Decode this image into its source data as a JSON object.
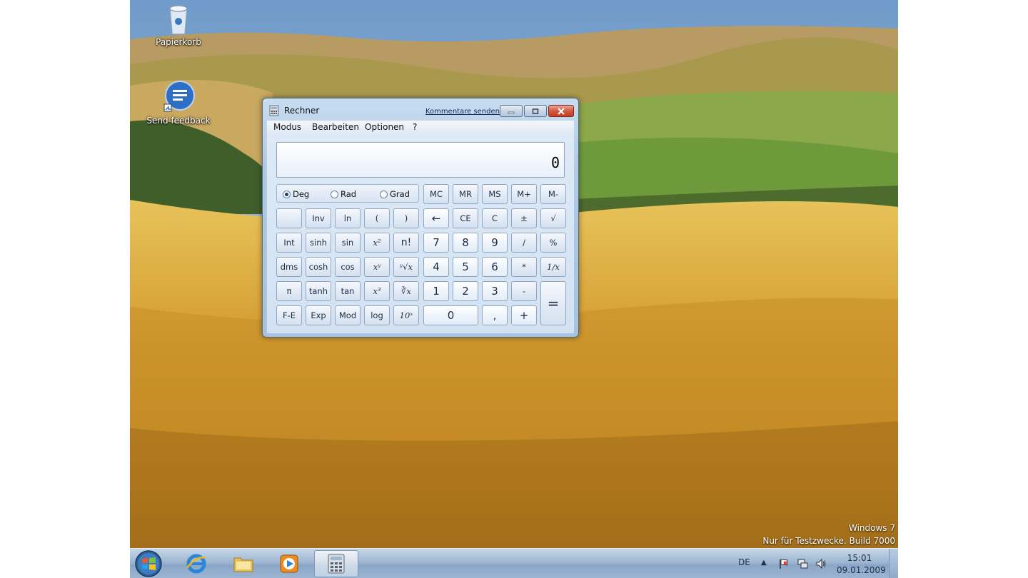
{
  "desktop": {
    "icons": [
      {
        "label": "Papierkorb",
        "icon": "recycle-bin-icon"
      },
      {
        "label": "Send feedback",
        "icon": "feedback-icon"
      }
    ],
    "watermark_os": "Windows 7",
    "watermark_build": "Nur für Testzwecke. Build 7000"
  },
  "calculator": {
    "title": "Rechner",
    "feedback_link": "Kommentare senden",
    "menu": [
      "Modus",
      "Bearbeiten",
      "Optionen",
      "?"
    ],
    "display": "0",
    "angle_modes": [
      "Deg",
      "Rad",
      "Grad"
    ],
    "selected_angle": "Deg",
    "memory_keys": [
      "MC",
      "MR",
      "MS",
      "M+",
      "M-"
    ],
    "rows": [
      [
        "",
        "Inv",
        "ln",
        "(",
        ")",
        "←",
        "CE",
        "C",
        "±",
        "√"
      ],
      [
        "Int",
        "sinh",
        "sin",
        "x²",
        "n!",
        "7",
        "8",
        "9",
        "/",
        "%"
      ],
      [
        "dms",
        "cosh",
        "cos",
        "xʸ",
        "ʸ√x",
        "4",
        "5",
        "6",
        "*",
        "1/x"
      ],
      [
        "π",
        "tanh",
        "tan",
        "x³",
        "∛x",
        "1",
        "2",
        "3",
        "-",
        "="
      ],
      [
        "F-E",
        "Exp",
        "Mod",
        "log",
        "10ˣ",
        "0",
        ",",
        "+"
      ]
    ]
  },
  "taskbar": {
    "language": "DE",
    "time": "15:01",
    "date": "09.01.2009",
    "apps": [
      "start-orb-icon",
      "internet-explorer-icon",
      "explorer-folder-icon",
      "media-player-icon",
      "calculator-icon"
    ]
  },
  "colors": {
    "sky": "#8fb3d9",
    "field": "#d8a93a",
    "taskbar": "#9fb6d1",
    "window_frame": "#b0cbe6"
  }
}
